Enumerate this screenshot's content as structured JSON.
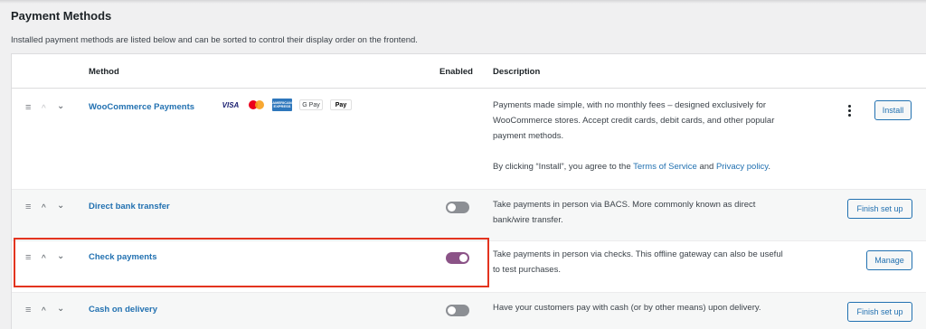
{
  "page": {
    "title": "Payment Methods",
    "description": "Installed payment methods are listed below and can be sorted to control their display order on the frontend."
  },
  "table": {
    "headers": {
      "method": "Method",
      "enabled": "Enabled",
      "description": "Description"
    }
  },
  "controls": {
    "drag": "≡",
    "up": "^",
    "down": "⌄"
  },
  "rows": [
    {
      "name": "WooCommerce Payments",
      "logos": [
        "VISA",
        "mastercard",
        "AMERICAN EXPRESS",
        "G Pay",
        "Pay"
      ],
      "description_lines": [
        "Payments made simple, with no monthly fees – designed exclusively for",
        "WooCommerce stores. Accept credit cards, debit cards, and other popular",
        "payment methods."
      ],
      "terms_prefix": "By clicking “Install”, you agree to the ",
      "terms_link": "Terms of Service",
      "terms_and": " and ",
      "privacy_link": "Privacy policy",
      "terms_suffix": ".",
      "button": "Install"
    },
    {
      "name": "Direct bank transfer",
      "enabled": false,
      "description_lines": [
        "Take payments in person via BACS. More commonly known as direct",
        "bank/wire transfer."
      ],
      "button": "Finish set up"
    },
    {
      "name": "Check payments",
      "enabled": true,
      "description_lines": [
        "Take payments in person via checks. This offline gateway can also be useful",
        "to test purchases."
      ],
      "button": "Manage"
    },
    {
      "name": "Cash on delivery",
      "enabled": false,
      "description_lines": [
        "Have your customers pay with cash (or by other means) upon delivery."
      ],
      "button": "Finish set up"
    }
  ],
  "colors": {
    "link": "#2271b1",
    "toggle_on": "#8b5387",
    "toggle_off": "#8c8f94",
    "highlight": "#e3341f"
  }
}
